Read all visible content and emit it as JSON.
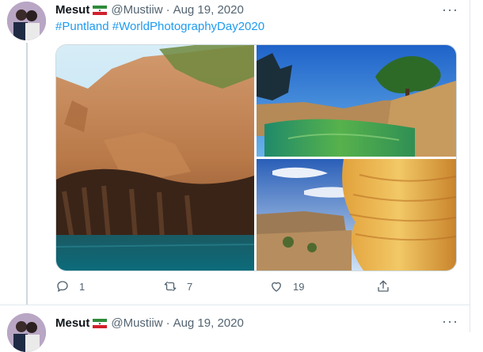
{
  "tweets": [
    {
      "author_name": "Mesut",
      "handle": "@Mustiiw",
      "date": "Aug 19, 2020",
      "hashtags": [
        "#Puntland",
        "#WorldPhotographyDay2020"
      ],
      "actions": {
        "replies": "1",
        "retweets": "7",
        "likes": "19"
      }
    },
    {
      "author_name": "Mesut",
      "handle": "@Mustiiw",
      "date": "Aug 19, 2020"
    }
  ],
  "separator": "·",
  "more_label": "···",
  "colors": {
    "link": "#1d9bf0",
    "muted": "#536471",
    "border": "#cfd9de"
  },
  "icons": {
    "reply": "reply-icon",
    "retweet": "retweet-icon",
    "like": "heart-icon",
    "share": "share-icon",
    "flag": "somaliland-flag-icon",
    "more": "more-icon"
  }
}
